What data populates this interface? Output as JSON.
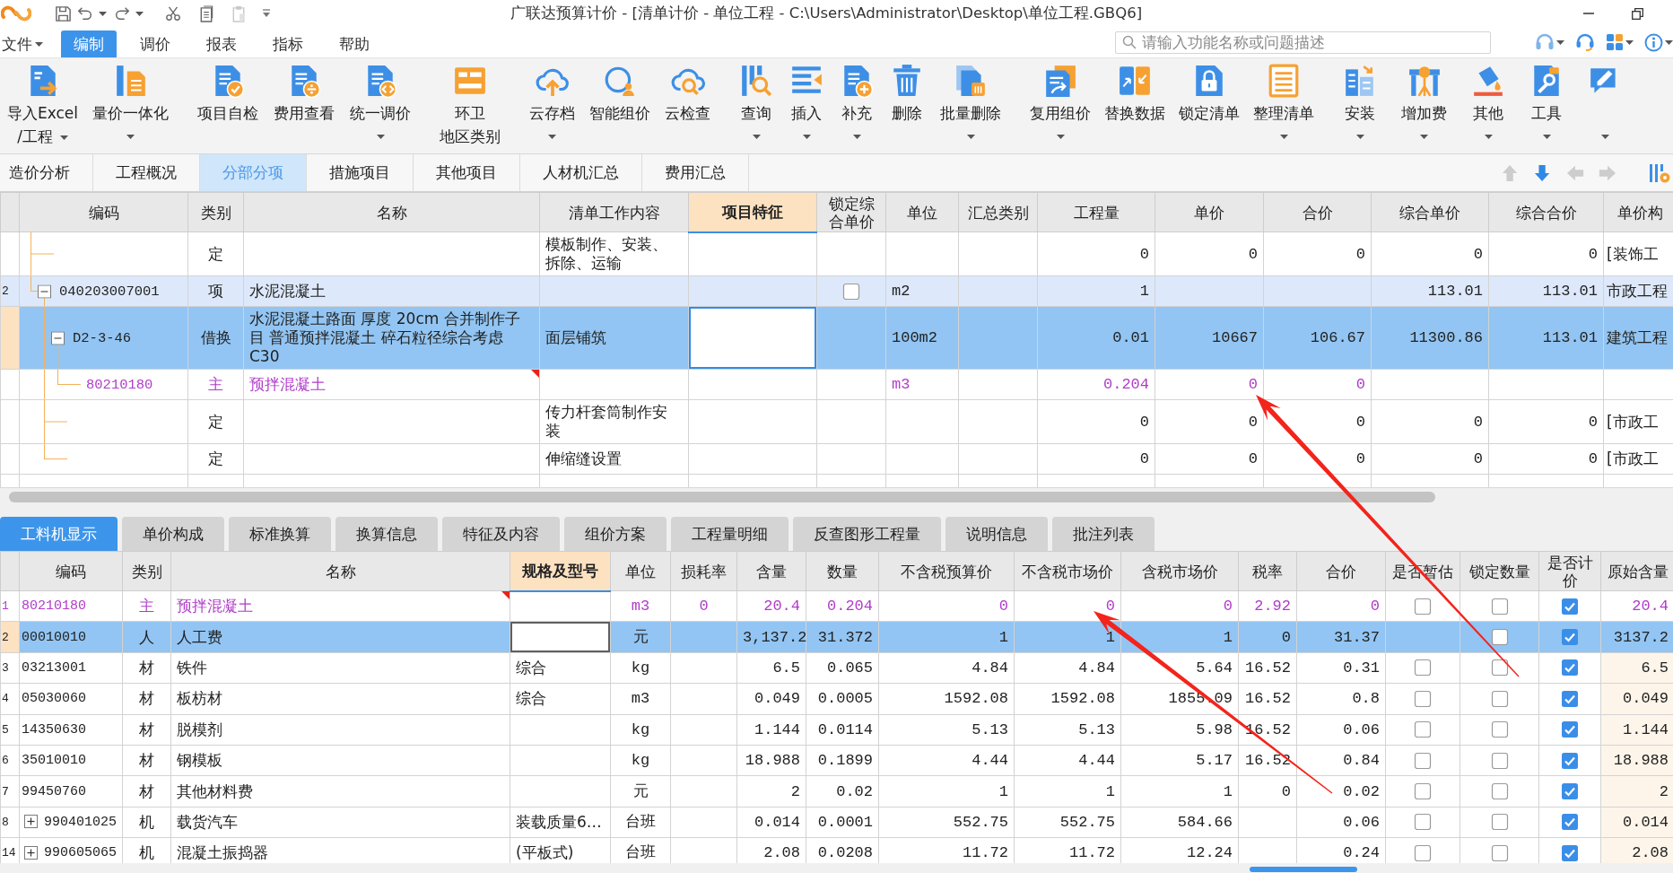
{
  "title_bar": {
    "title": "广联达预算计价 - [清单计价 - 单位工程 - C:\\Users\\Administrator\\Desktop\\单位工程.GBQ6]"
  },
  "menu": [
    {
      "label": "文件",
      "selected": false,
      "dropdown": true
    },
    {
      "label": "编制",
      "selected": true,
      "dropdown": false
    },
    {
      "label": "调价",
      "selected": false,
      "dropdown": false
    },
    {
      "label": "报表",
      "selected": false,
      "dropdown": false
    },
    {
      "label": "指标",
      "selected": false,
      "dropdown": false
    },
    {
      "label": "帮助",
      "selected": false,
      "dropdown": false
    }
  ],
  "search": {
    "placeholder": "请输入功能名称或问题描述"
  },
  "toolbar": {
    "groups": [
      {
        "items": [
          {
            "lines": [
              "导入Excel",
              "/工程"
            ],
            "dropdown": true
          },
          {
            "lines": [
              "量价一体化"
            ],
            "dropdown": true
          }
        ]
      },
      {
        "items": [
          {
            "lines": [
              "项目自检"
            ],
            "dropdown": false
          },
          {
            "lines": [
              "费用查看"
            ],
            "dropdown": false
          },
          {
            "lines": [
              "统一调价"
            ],
            "dropdown": true
          }
        ]
      },
      {
        "items": [
          {
            "lines": [
              "环卫",
              "地区类别"
            ],
            "dropdown": false
          }
        ]
      },
      {
        "items": [
          {
            "lines": [
              "云存档"
            ],
            "dropdown": true
          },
          {
            "lines": [
              "智能组价"
            ],
            "dropdown": false
          },
          {
            "lines": [
              "云检查"
            ],
            "dropdown": false
          }
        ]
      },
      {
        "items": [
          {
            "lines": [
              "查询"
            ],
            "dropdown": true
          },
          {
            "lines": [
              "插入"
            ],
            "dropdown": true
          },
          {
            "lines": [
              "补充"
            ],
            "dropdown": true
          },
          {
            "lines": [
              "删除"
            ],
            "dropdown": false
          },
          {
            "lines": [
              "批量删除"
            ],
            "dropdown": true
          }
        ]
      },
      {
        "items": [
          {
            "lines": [
              "复用组价"
            ],
            "dropdown": true
          },
          {
            "lines": [
              "替换数据"
            ],
            "dropdown": false
          },
          {
            "lines": [
              "锁定清单"
            ],
            "dropdown": false
          },
          {
            "lines": [
              "整理清单"
            ],
            "dropdown": true
          }
        ]
      },
      {
        "items": [
          {
            "lines": [
              "安装"
            ],
            "dropdown": true
          },
          {
            "lines": [
              "增加费"
            ],
            "dropdown": true
          },
          {
            "lines": [
              "其他"
            ],
            "dropdown": true
          },
          {
            "lines": [
              "工具"
            ],
            "dropdown": true
          },
          {
            "dropdown": true
          }
        ]
      }
    ]
  },
  "view_tabs": [
    {
      "label": "造价分析",
      "selected": false
    },
    {
      "label": "工程概况",
      "selected": false
    },
    {
      "label": "分部分项",
      "selected": true
    },
    {
      "label": "措施项目",
      "selected": false
    },
    {
      "label": "其他项目",
      "selected": false
    },
    {
      "label": "人材机汇总",
      "selected": false
    },
    {
      "label": "费用汇总",
      "selected": false
    }
  ],
  "nav_buttons": [
    {
      "disabled": true
    },
    {
      "disabled": false
    },
    {
      "disabled": true
    },
    {
      "disabled": true
    }
  ],
  "bill_table": {
    "columns": [
      {
        "label": "编码",
        "selected": false
      },
      {
        "label": "类别",
        "selected": false
      },
      {
        "label": "名称",
        "selected": false
      },
      {
        "label": "清单工作内容",
        "selected": false
      },
      {
        "label": "项目特征",
        "selected": true
      },
      {
        "label": "锁定综合单价",
        "selected": false
      },
      {
        "label": "单位",
        "selected": false
      },
      {
        "label": "汇总类别",
        "selected": false
      },
      {
        "label": "工程量",
        "selected": false
      },
      {
        "label": "单价",
        "selected": false
      },
      {
        "label": "合价",
        "selected": false
      },
      {
        "label": "综合单价",
        "selected": false
      },
      {
        "label": "综合合价",
        "selected": false
      },
      {
        "label": "单价构",
        "selected": false
      }
    ],
    "rows": [
      {
        "type": "定",
        "work_content": "模板制作、安装、拆除、运输",
        "quantity": "0",
        "unit_price": "0",
        "total": "0",
        "composite_unit_price": "0",
        "composite_total": "0",
        "price_composition": "[装饰工",
        "kind": "quota",
        "selected": false,
        "noted": false
      },
      {
        "row_number": "2",
        "code": "040203007001",
        "type": "项",
        "name": "水泥混凝土",
        "lock_price": false,
        "unit": "m2",
        "quantity": "1",
        "composite_unit_price": "113.01",
        "composite_total": "113.01",
        "price_composition": "市政工程",
        "kind": "bill_item",
        "selected": false,
        "noted": false,
        "expanded": true,
        "children": [
          {
            "code": "D2-3-46",
            "type": "借换",
            "name": "水泥混凝土路面 厚度 20cm 合并制作子目 普通预拌混凝土 碎石粒径综合考虑 C30",
            "work_content": "面层铺筑",
            "unit": "100m2",
            "quantity": "0.01",
            "unit_price": "10667",
            "total": "106.67",
            "composite_unit_price": "11300.86",
            "composite_total": "113.01",
            "price_composition": "建筑工程",
            "kind": "quota",
            "selected": true,
            "noted": false,
            "expanded": true,
            "children": [
              {
                "code": "80210180",
                "type": "主",
                "name": "预拌混凝土",
                "unit": "m3",
                "quantity": "0.204",
                "unit_price": "0",
                "total": "0",
                "kind": "main_material",
                "selected": false,
                "noted": true
              }
            ]
          },
          {
            "type": "定",
            "work_content": "传力杆套筒制作安装",
            "quantity": "0",
            "unit_price": "0",
            "total": "0",
            "composite_unit_price": "0",
            "composite_total": "0",
            "price_composition": "[市政工",
            "kind": "quota",
            "selected": false,
            "noted": false
          },
          {
            "type": "定",
            "work_content": "伸缩缝设置",
            "quantity": "0",
            "unit_price": "0",
            "total": "0",
            "composite_unit_price": "0",
            "composite_total": "0",
            "price_composition": "[市政工",
            "kind": "quota",
            "selected": false,
            "noted": false
          }
        ]
      }
    ]
  },
  "detail_tabs": [
    {
      "label": "工料机显示",
      "selected": true
    },
    {
      "label": "单价构成",
      "selected": false
    },
    {
      "label": "标准换算",
      "selected": false
    },
    {
      "label": "换算信息",
      "selected": false
    },
    {
      "label": "特征及内容",
      "selected": false
    },
    {
      "label": "组价方案",
      "selected": false
    },
    {
      "label": "工程量明细",
      "selected": false
    },
    {
      "label": "反查图形工程量",
      "selected": false
    },
    {
      "label": "说明信息",
      "selected": false
    },
    {
      "label": "批注列表",
      "selected": false
    }
  ],
  "resource_table": {
    "columns": [
      {
        "label": "编码",
        "selected": false
      },
      {
        "label": "类别",
        "selected": false
      },
      {
        "label": "名称",
        "selected": false
      },
      {
        "label": "规格及型号",
        "selected": true
      },
      {
        "label": "单位",
        "selected": false
      },
      {
        "label": "损耗率",
        "selected": false
      },
      {
        "label": "含量",
        "selected": false
      },
      {
        "label": "数量",
        "selected": false
      },
      {
        "label": "不含税预算价",
        "selected": false
      },
      {
        "label": "不含税市场价",
        "selected": false
      },
      {
        "label": "含税市场价",
        "selected": false
      },
      {
        "label": "税率",
        "selected": false
      },
      {
        "label": "合价",
        "selected": false
      },
      {
        "label": "是否暂估",
        "selected": false
      },
      {
        "label": "锁定数量",
        "selected": false
      },
      {
        "label": "是否计价",
        "selected": false
      },
      {
        "label": "原始含量",
        "selected": false
      }
    ],
    "rows": [
      {
        "row_number": "1",
        "code": "80210180",
        "type": "主",
        "name": "预拌混凝土",
        "unit": "m3",
        "loss_rate": "0",
        "content": "20.4",
        "quantity": "0.204",
        "budget_price": "0",
        "market_price": "0",
        "market_price_tax": "0",
        "tax_rate": "2.92",
        "total": "0",
        "provisional": false,
        "lock_quantity": false,
        "priced": true,
        "original_content": "20.4",
        "kind": "main_material",
        "selected": false,
        "noted": true
      },
      {
        "row_number": "2",
        "code": "00010010",
        "type": "人",
        "name": "人工费",
        "unit": "元",
        "content": "3,137.2",
        "quantity": "31.372",
        "budget_price": "1",
        "market_price": "1",
        "market_price_tax": "1",
        "tax_rate": "0",
        "total": "31.37",
        "lock_quantity": false,
        "priced": true,
        "original_content": "3137.2",
        "kind": "normal",
        "selected": true,
        "noted": false
      },
      {
        "row_number": "3",
        "code": "03213001",
        "type": "材",
        "name": "铁件",
        "spec": "综合",
        "unit": "kg",
        "content": "6.5",
        "quantity": "0.065",
        "budget_price": "4.84",
        "market_price": "4.84",
        "market_price_tax": "5.64",
        "tax_rate": "16.52",
        "total": "0.31",
        "provisional": false,
        "lock_quantity": false,
        "priced": true,
        "original_content": "6.5",
        "kind": "normal",
        "selected": false,
        "noted": false
      },
      {
        "row_number": "4",
        "code": "05030060",
        "type": "材",
        "name": "板枋材",
        "spec": "综合",
        "unit": "m3",
        "content": "0.049",
        "quantity": "0.0005",
        "budget_price": "1592.08",
        "market_price": "1592.08",
        "market_price_tax": "1855.09",
        "tax_rate": "16.52",
        "total": "0.8",
        "provisional": false,
        "lock_quantity": false,
        "priced": true,
        "original_content": "0.049",
        "kind": "normal",
        "selected": false,
        "noted": false
      },
      {
        "row_number": "5",
        "code": "14350630",
        "type": "材",
        "name": "脱模剂",
        "unit": "kg",
        "content": "1.144",
        "quantity": "0.0114",
        "budget_price": "5.13",
        "market_price": "5.13",
        "market_price_tax": "5.98",
        "tax_rate": "16.52",
        "total": "0.06",
        "provisional": false,
        "lock_quantity": false,
        "priced": true,
        "original_content": "1.144",
        "kind": "normal",
        "selected": false,
        "noted": false
      },
      {
        "row_number": "6",
        "code": "35010010",
        "type": "材",
        "name": "钢模板",
        "unit": "kg",
        "content": "18.988",
        "quantity": "0.1899",
        "budget_price": "4.44",
        "market_price": "4.44",
        "market_price_tax": "5.17",
        "tax_rate": "16.52",
        "total": "0.84",
        "provisional": false,
        "lock_quantity": false,
        "priced": true,
        "original_content": "18.988",
        "kind": "normal",
        "selected": false,
        "noted": false
      },
      {
        "row_number": "7",
        "code": "99450760",
        "type": "材",
        "name": "其他材料费",
        "unit": "元",
        "content": "2",
        "quantity": "0.02",
        "budget_price": "1",
        "market_price": "1",
        "market_price_tax": "1",
        "tax_rate": "0",
        "total": "0.02",
        "provisional": false,
        "lock_quantity": false,
        "priced": true,
        "original_content": "2",
        "kind": "normal",
        "selected": false,
        "noted": false
      },
      {
        "row_number": "8",
        "code": "990401025",
        "type": "机",
        "name": "载货汽车",
        "spec": "装载质量6…",
        "unit": "台班",
        "content": "0.014",
        "quantity": "0.0001",
        "budget_price": "552.75",
        "market_price": "552.75",
        "market_price_tax": "584.66",
        "total": "0.06",
        "provisional": false,
        "lock_quantity": false,
        "priced": true,
        "original_content": "0.014",
        "kind": "normal",
        "selected": false,
        "noted": false,
        "expanded": false
      },
      {
        "row_number": "14",
        "code": "990605065",
        "type": "机",
        "name": "混凝土振捣器",
        "spec": "(平板式)",
        "unit": "台班",
        "content": "2.08",
        "quantity": "0.0208",
        "budget_price": "11.72",
        "market_price": "11.72",
        "market_price_tax": "12.24",
        "total": "0.24",
        "provisional": false,
        "lock_quantity": false,
        "priced": true,
        "original_content": "2.08",
        "kind": "normal",
        "selected": false,
        "noted": false,
        "expanded": false
      }
    ]
  }
}
